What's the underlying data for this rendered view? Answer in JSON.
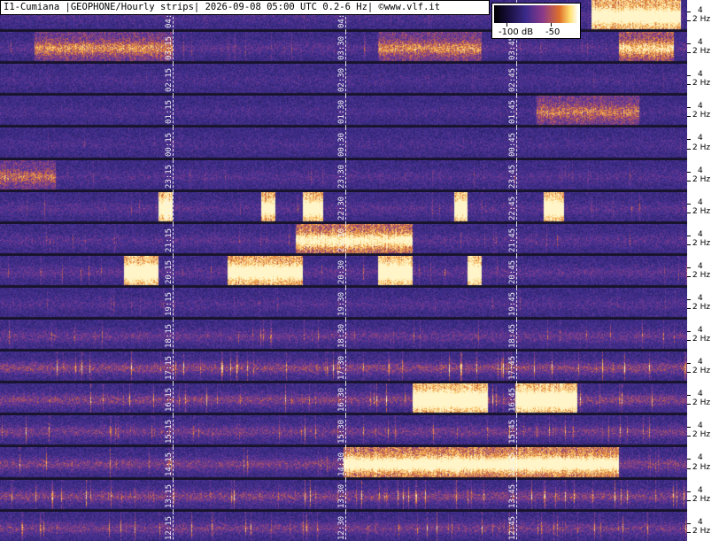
{
  "header": {
    "title": "I1-Cumiana |GEOPHONE/Hourly strips| 2026-09-08 05:00 UTC 0.2-6 Hz| ©www.vlf.it"
  },
  "legend": {
    "label_low": "-100 dB",
    "label_high": "-50"
  },
  "axis": {
    "label_4": "4",
    "label_2": "2 Hz"
  },
  "strips": [
    {
      "ticks": [
        "04:15",
        "04:30",
        "04:45"
      ],
      "activity": 0.25,
      "bursts": [
        [
          0.86,
          0.99,
          0.9
        ]
      ]
    },
    {
      "ticks": [
        "03:15",
        "03:30",
        "03:45"
      ],
      "activity": 0.35,
      "bursts": [
        [
          0.05,
          0.25,
          0.35
        ],
        [
          0.55,
          0.7,
          0.35
        ],
        [
          0.9,
          0.98,
          0.5
        ]
      ]
    },
    {
      "ticks": [
        "02:15",
        "02:30",
        "02:45"
      ],
      "activity": 0.2,
      "bursts": []
    },
    {
      "ticks": [
        "01:15",
        "01:30",
        "01:45"
      ],
      "activity": 0.2,
      "bursts": [
        [
          0.78,
          0.93,
          0.35
        ]
      ]
    },
    {
      "ticks": [
        "00:15",
        "00:30",
        "00:45"
      ],
      "activity": 0.2,
      "bursts": []
    },
    {
      "ticks": [
        "23:15",
        "23:30",
        "23:45"
      ],
      "activity": 0.3,
      "bursts": [
        [
          0.0,
          0.08,
          0.3
        ]
      ]
    },
    {
      "ticks": [
        "22:15",
        "22:30",
        "22:45"
      ],
      "activity": 0.35,
      "bursts": [
        [
          0.23,
          0.25,
          0.95
        ],
        [
          0.38,
          0.4,
          0.9
        ],
        [
          0.44,
          0.47,
          0.95
        ],
        [
          0.66,
          0.68,
          0.95
        ],
        [
          0.79,
          0.82,
          0.95
        ]
      ]
    },
    {
      "ticks": [
        "21:15",
        "21:30",
        "21:45"
      ],
      "activity": 0.35,
      "bursts": [
        [
          0.43,
          0.6,
          0.65
        ]
      ]
    },
    {
      "ticks": [
        "20:15",
        "20:30",
        "20:45"
      ],
      "activity": 0.4,
      "bursts": [
        [
          0.18,
          0.23,
          0.95
        ],
        [
          0.33,
          0.44,
          0.85
        ],
        [
          0.55,
          0.6,
          0.95
        ],
        [
          0.68,
          0.7,
          0.95
        ]
      ]
    },
    {
      "ticks": [
        "19:15",
        "19:30",
        "19:45"
      ],
      "activity": 0.3,
      "bursts": []
    },
    {
      "ticks": [
        "18:15",
        "18:30",
        "18:45"
      ],
      "activity": 0.5,
      "bursts": []
    },
    {
      "ticks": [
        "17:15",
        "17:30",
        "17:45"
      ],
      "activity": 0.75,
      "bursts": []
    },
    {
      "ticks": [
        "16:15",
        "16:30",
        "16:45"
      ],
      "activity": 0.7,
      "bursts": [
        [
          0.6,
          0.71,
          0.95
        ],
        [
          0.75,
          0.84,
          0.95
        ]
      ]
    },
    {
      "ticks": [
        "15:15",
        "15:30",
        "15:45"
      ],
      "activity": 0.6,
      "bursts": []
    },
    {
      "ticks": [
        "14:15",
        "14:30",
        "14:45"
      ],
      "activity": 0.65,
      "bursts": [
        [
          0.5,
          0.9,
          0.7
        ]
      ]
    },
    {
      "ticks": [
        "13:15",
        "13:30",
        "13:45"
      ],
      "activity": 0.7,
      "bursts": []
    },
    {
      "ticks": [
        "12:15",
        "12:30",
        "12:45"
      ],
      "activity": 0.6,
      "bursts": []
    }
  ]
}
